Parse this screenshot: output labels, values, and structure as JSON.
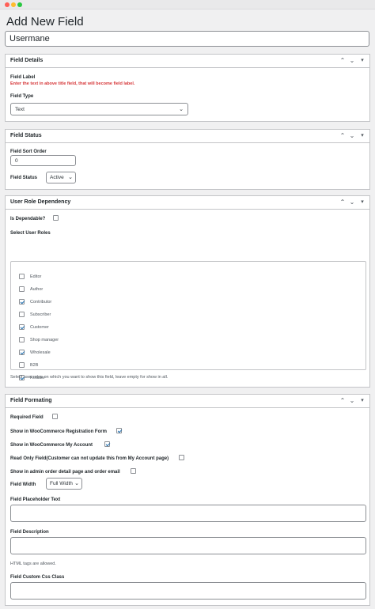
{
  "page": {
    "title": "Add New Field"
  },
  "title_field": {
    "value": "Usermane"
  },
  "field_details": {
    "title": "Field Details",
    "label_heading": "Field Label",
    "label_hint": "Enter the text in above title field, that will become field label.",
    "type_label": "Field Type",
    "type_value": "Text"
  },
  "field_status": {
    "title": "Field Status",
    "sort_label": "Field Sort Order",
    "sort_value": "0",
    "status_label": "Field Status",
    "status_value": "Active"
  },
  "user_role": {
    "title": "User Role Dependency",
    "dependable_label": "Is Dependable?",
    "dependable_checked": false,
    "roles_label": "Select User Roles",
    "roles": [
      {
        "name": "Editor",
        "checked": false
      },
      {
        "name": "Author",
        "checked": false
      },
      {
        "name": "Contributor",
        "checked": true
      },
      {
        "name": "Subscriber",
        "checked": false
      },
      {
        "name": "Customer",
        "checked": true
      },
      {
        "name": "Shop manager",
        "checked": false
      },
      {
        "name": "Wholesale",
        "checked": true
      },
      {
        "name": "B2B",
        "checked": false
      },
      {
        "name": "Retailer",
        "checked": true
      }
    ],
    "roles_hint": "Select user roles on which you want to show this field, leave empty for show in all."
  },
  "formatting": {
    "title": "Field Formating",
    "options": [
      {
        "label": "Required Field",
        "checked": false
      },
      {
        "label": "Show in WooCommerce Registration Form",
        "checked": true
      },
      {
        "label": "Show in WooCommerce My Account",
        "checked": true
      },
      {
        "label": "Read Only Field(Customer can not update this from My Account page)",
        "checked": false
      },
      {
        "label": "Show in admin order detail page and order email",
        "checked": false
      }
    ],
    "width_label": "Field Width",
    "width_value": "Full Width",
    "placeholder_label": "Field Placeholder Text",
    "description_label": "Field Description",
    "description_hint": "HTML tags are allowed.",
    "css_label": "Field Custom Css Class"
  },
  "colors": {
    "accent": "#2271b1",
    "warning": "#d63638",
    "border": "#c3c4c7"
  },
  "icons": {
    "move_up": "chevron-up-icon",
    "move_down": "chevron-down-icon",
    "toggle": "caret-down-icon"
  }
}
